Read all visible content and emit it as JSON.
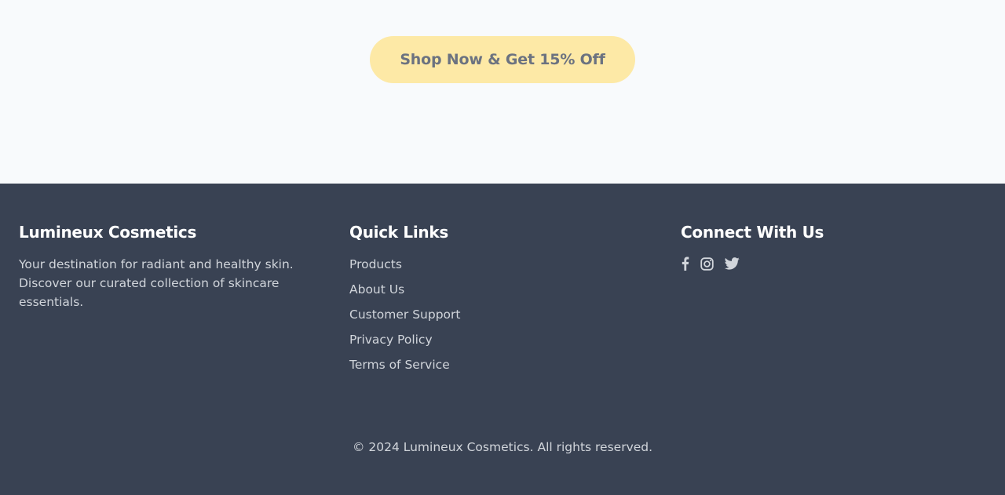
{
  "hero": {
    "cta_label": "Shop Now & Get 15% Off"
  },
  "footer": {
    "brand": {
      "title": "Lumineux Cosmetics",
      "description": "Your destination for radiant and healthy skin. Discover our curated collection of skincare essentials."
    },
    "quick_links": {
      "title": "Quick Links",
      "items": [
        {
          "label": "Products"
        },
        {
          "label": "About Us"
        },
        {
          "label": "Customer Support"
        },
        {
          "label": "Privacy Policy"
        },
        {
          "label": "Terms of Service"
        }
      ]
    },
    "social": {
      "title": "Connect With Us",
      "icons": [
        "facebook-icon",
        "instagram-icon",
        "twitter-icon"
      ]
    },
    "copyright": "© 2024 Lumineux Cosmetics. All rights reserved."
  },
  "colors": {
    "hero_background": "#f8fafc",
    "cta_background": "#fde9a6",
    "cta_text": "#6b7280",
    "footer_background": "#394253",
    "footer_heading": "#ffffff",
    "footer_text": "#d1d5db"
  }
}
